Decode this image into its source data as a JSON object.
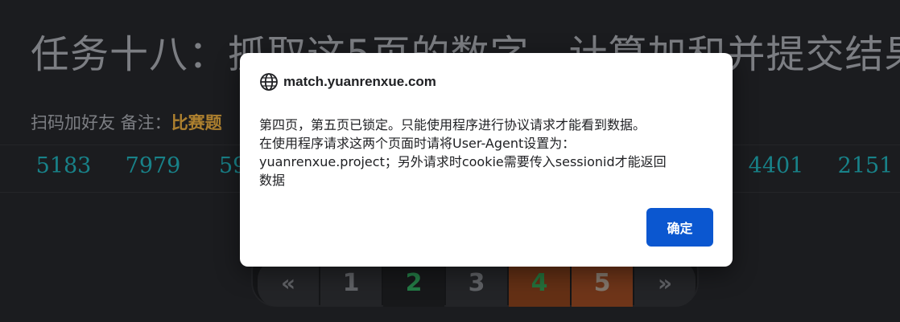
{
  "page": {
    "title": "任务十八：抓取这5页的数字，计算加和并提交结果",
    "subtitle_prefix": "扫码加好友 备注：",
    "subtitle_highlight": "比赛题"
  },
  "numbers": [
    "5183",
    "7979",
    "59",
    "4401",
    "2151"
  ],
  "pagination": {
    "prev": "«",
    "pages": [
      "1",
      "2",
      "3",
      "4",
      "5"
    ],
    "current": "2",
    "next": "»"
  },
  "dialog": {
    "origin": "match.yuanrenxue.com",
    "message": "第四页，第五页已锁定。只能使用程序进行协议请求才能看到数据。\n在使用程序请求这两个页面时请将User-Agent设置为：\nyuanrenxue.project；另外请求时cookie需要传入sessionid才能返回\n数据",
    "ok_label": "确定"
  },
  "colors": {
    "background": "#222327",
    "number_text": "#1fa3ac",
    "highlight": "#d9a13b",
    "dialog_button": "#0b57d0"
  },
  "icons": {
    "dialog_origin": "globe-icon"
  }
}
